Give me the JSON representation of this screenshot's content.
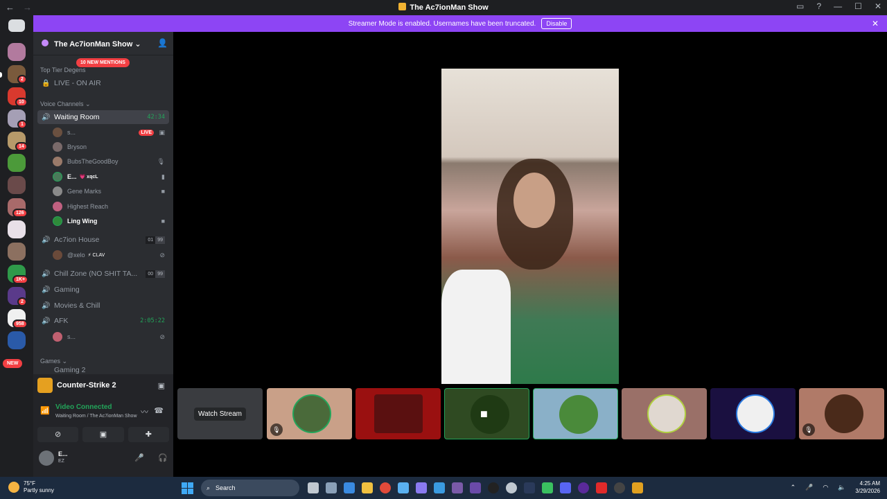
{
  "window": {
    "title": "The Ac7ionMan Show"
  },
  "banner": {
    "text": "Streamer Mode is enabled. Usernames have been truncated.",
    "disable_label": "Disable"
  },
  "rail": {
    "badges": [
      "2",
      "10",
      "1",
      "14",
      "126",
      "1K+",
      "2",
      "958"
    ],
    "new_label": "NEW"
  },
  "server": {
    "name": "The Ac7ionMan Show",
    "mentions": "10 NEW MENTIONS"
  },
  "categories": {
    "top": "Top Tier Degens",
    "voice": "Voice Channels",
    "games": "Games"
  },
  "channels": {
    "live_on_air": "LIVE - ON AIR",
    "waiting_room": {
      "name": "Waiting Room",
      "timer": "42:34"
    },
    "action_house": {
      "name": "Ac7ion House",
      "count_a": "01",
      "count_b": "99"
    },
    "chill_zone": {
      "name": "Chill Zone (NO SHIT TA...",
      "count_a": "00",
      "count_b": "99"
    },
    "gaming": "Gaming",
    "movies": "Movies & Chill",
    "afk": {
      "name": "AFK",
      "timer": "2:05:22"
    },
    "gaming2": "Gaming 2"
  },
  "voice_users": {
    "waiting": [
      {
        "name": "s...",
        "live": "LIVE"
      },
      {
        "name": "Bryson"
      },
      {
        "name": "BubsTheGoodBoy"
      },
      {
        "name": "E...",
        "tag": "💗 xqcL"
      },
      {
        "name": "Gene Marks"
      },
      {
        "name": "Highest Reach"
      },
      {
        "name": "Ling Wing"
      }
    ],
    "action_house": [
      {
        "name": "@xelo",
        "tag": "⚡ CLAV"
      }
    ],
    "afk": [
      {
        "name": "s..."
      }
    ]
  },
  "panel": {
    "game": "Counter-Strike 2",
    "status": "Video Connected",
    "location": "Waiting Room / The Ac7ionMan Show",
    "user_name": "E...",
    "user_status": "EZ"
  },
  "tiles": {
    "watch_label": "Watch Stream"
  },
  "taskbar": {
    "temp": "75°F",
    "weather": "Partly sunny",
    "search": "Search",
    "time": "4:25 AM",
    "date": "3/29/2026"
  },
  "colors": {
    "accent": "#8d45f4",
    "live": "#f23f43",
    "voice_green": "#23a55a"
  }
}
